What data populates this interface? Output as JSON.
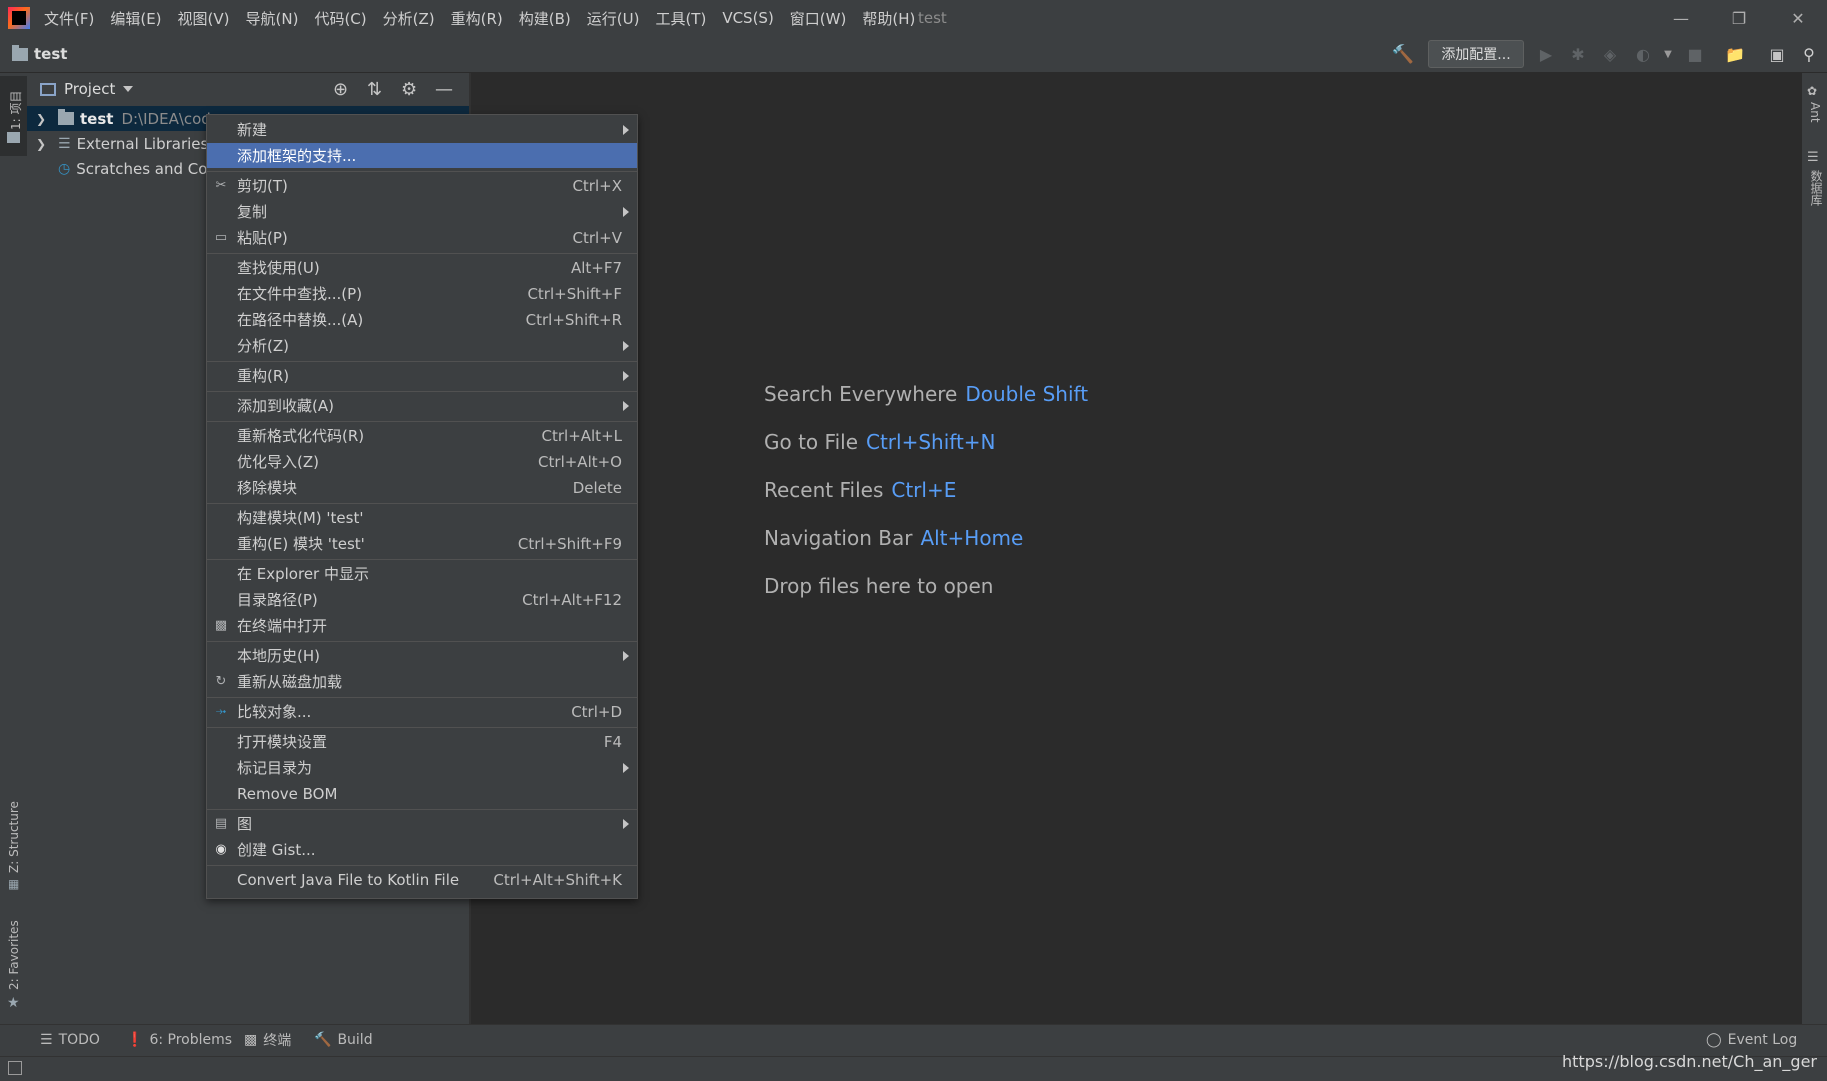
{
  "menubar": {
    "items": [
      "文件(F)",
      "编辑(E)",
      "视图(V)",
      "导航(N)",
      "代码(C)",
      "分析(Z)",
      "重构(R)",
      "构建(B)",
      "运行(U)",
      "工具(T)",
      "VCS(S)",
      "窗口(W)",
      "帮助(H)"
    ],
    "window_title": "test"
  },
  "toolbar": {
    "breadcrumb": "test",
    "add_config_label": "添加配置..."
  },
  "left_stripe": {
    "project_tab": "1: 项目",
    "structure_tab": "Z: Structure",
    "favorites_tab": "2: Favorites"
  },
  "right_stripe": {
    "ant_tab": "Ant",
    "database_tab": "数据库"
  },
  "project_panel": {
    "title": "Project",
    "tree": [
      {
        "name": "test",
        "path": "D:\\IDEA\\cod"
      },
      {
        "name": "External Libraries"
      },
      {
        "name": "Scratches and Co"
      }
    ]
  },
  "context_menu": {
    "items": [
      {
        "label": "新建",
        "shortcut": "",
        "submenu": true
      },
      {
        "label": "添加框架的支持...",
        "shortcut": "",
        "selected": true
      },
      {
        "label": "剪切(T)",
        "shortcut": "Ctrl+X",
        "icon": "scissors-icon"
      },
      {
        "label": "复制",
        "shortcut": "",
        "submenu": true
      },
      {
        "label": "粘贴(P)",
        "shortcut": "Ctrl+V",
        "icon": "clipboard-icon"
      },
      {
        "label": "查找使用(U)",
        "shortcut": "Alt+F7"
      },
      {
        "label": "在文件中查找...(P)",
        "shortcut": "Ctrl+Shift+F"
      },
      {
        "label": "在路径中替换...(A)",
        "shortcut": "Ctrl+Shift+R"
      },
      {
        "label": "分析(Z)",
        "shortcut": "",
        "submenu": true
      },
      {
        "label": "重构(R)",
        "shortcut": "",
        "submenu": true
      },
      {
        "label": "添加到收藏(A)",
        "shortcut": "",
        "submenu": true
      },
      {
        "label": "重新格式化代码(R)",
        "shortcut": "Ctrl+Alt+L"
      },
      {
        "label": "优化导入(Z)",
        "shortcut": "Ctrl+Alt+O"
      },
      {
        "label": "移除模块",
        "shortcut": "Delete"
      },
      {
        "label": "构建模块(M) 'test'",
        "shortcut": ""
      },
      {
        "label": "重构(E) 模块 'test'",
        "shortcut": "Ctrl+Shift+F9"
      },
      {
        "label": "在 Explorer 中显示",
        "shortcut": ""
      },
      {
        "label": "目录路径(P)",
        "shortcut": "Ctrl+Alt+F12"
      },
      {
        "label": "在终端中打开",
        "shortcut": "",
        "icon": "terminal-icon"
      },
      {
        "label": "本地历史(H)",
        "shortcut": "",
        "submenu": true
      },
      {
        "label": "重新从磁盘加载",
        "shortcut": "",
        "icon": "reload-icon"
      },
      {
        "label": "比较对象...",
        "shortcut": "Ctrl+D",
        "icon": "compare-icon"
      },
      {
        "label": "打开模块设置",
        "shortcut": "F4"
      },
      {
        "label": "标记目录为",
        "shortcut": "",
        "submenu": true
      },
      {
        "label": "Remove BOM",
        "shortcut": ""
      },
      {
        "label": "图",
        "shortcut": "",
        "submenu": true,
        "icon": "diagram-icon"
      },
      {
        "label": "创建 Gist...",
        "shortcut": "",
        "icon": "github-icon"
      },
      {
        "label": "Convert Java File to Kotlin File",
        "shortcut": "Ctrl+Alt+Shift+K"
      }
    ]
  },
  "editor_hints": [
    {
      "text": "Search Everywhere",
      "key": "Double Shift"
    },
    {
      "text": "Go to File",
      "key": "Ctrl+Shift+N"
    },
    {
      "text": "Recent Files",
      "key": "Ctrl+E"
    },
    {
      "text": "Navigation Bar",
      "key": "Alt+Home"
    },
    {
      "text": "Drop files here to open",
      "key": ""
    }
  ],
  "bottom_tools": {
    "todo": "TODO",
    "problems": "6: Problems",
    "terminal": "终端",
    "build": "Build",
    "event_log": "Event Log"
  },
  "watermark": "https://blog.csdn.net/Ch_an_ger",
  "colors": {
    "background": "#2b2b2b",
    "panel": "#3c3f41",
    "selection": "#4b6eaf",
    "shortcut_blue": "#589df6",
    "build_green": "#499c54"
  }
}
